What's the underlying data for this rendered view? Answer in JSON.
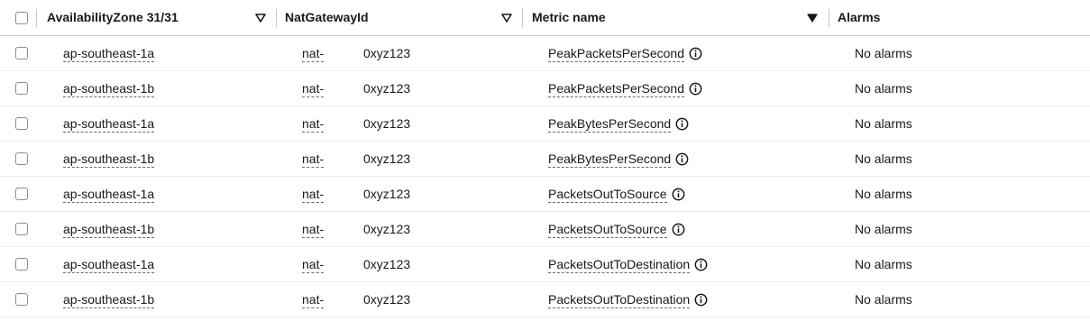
{
  "header": {
    "select_all": "",
    "availability_zone_label": "AvailabilityZone 31/31",
    "nat_gateway_label": "NatGatewayId",
    "metric_name_label": "Metric name",
    "alarms_label": "Alarms"
  },
  "rows": [
    {
      "az": "ap-southeast-1a",
      "nat_prefix": "nat-",
      "nat_suffix": "0xyz123",
      "metric": "PeakPacketsPerSecond",
      "alarms": "No alarms"
    },
    {
      "az": "ap-southeast-1b",
      "nat_prefix": "nat-",
      "nat_suffix": "0xyz123",
      "metric": "PeakPacketsPerSecond",
      "alarms": "No alarms"
    },
    {
      "az": "ap-southeast-1a",
      "nat_prefix": "nat-",
      "nat_suffix": "0xyz123",
      "metric": "PeakBytesPerSecond",
      "alarms": "No alarms"
    },
    {
      "az": "ap-southeast-1b",
      "nat_prefix": "nat-",
      "nat_suffix": "0xyz123",
      "metric": "PeakBytesPerSecond",
      "alarms": "No alarms"
    },
    {
      "az": "ap-southeast-1a",
      "nat_prefix": "nat-",
      "nat_suffix": "0xyz123",
      "metric": "PacketsOutToSource",
      "alarms": "No alarms"
    },
    {
      "az": "ap-southeast-1b",
      "nat_prefix": "nat-",
      "nat_suffix": "0xyz123",
      "metric": "PacketsOutToSource",
      "alarms": "No alarms"
    },
    {
      "az": "ap-southeast-1a",
      "nat_prefix": "nat-",
      "nat_suffix": "0xyz123",
      "metric": "PacketsOutToDestination",
      "alarms": "No alarms"
    },
    {
      "az": "ap-southeast-1b",
      "nat_prefix": "nat-",
      "nat_suffix": "0xyz123",
      "metric": "PacketsOutToDestination",
      "alarms": "No alarms"
    }
  ],
  "icons": {
    "sort_filter": "caret-down-outline-icon",
    "sort_active": "caret-down-filled-icon",
    "info": "info-circle-icon"
  }
}
